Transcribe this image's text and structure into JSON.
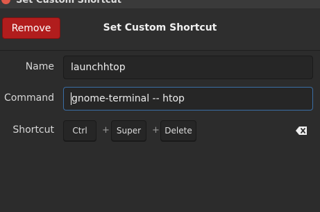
{
  "window": {
    "title": "Set Custom Shortcut"
  },
  "header": {
    "remove_label": "Remove",
    "title": "Set Custom Shortcut"
  },
  "form": {
    "name_label": "Name",
    "name_value": "launchhtop",
    "command_label": "Command",
    "command_value": "gnome-terminal -- htop",
    "shortcut_label": "Shortcut",
    "shortcut_keys": [
      "Ctrl",
      "Super",
      "Delete"
    ],
    "separator": "+"
  },
  "colors": {
    "remove_button": "#b11d1d",
    "focus_border": "#3a6ea5",
    "background": "#2c2c2c"
  },
  "icons": {
    "window_close": "close-icon",
    "clear_shortcut": "backspace-clear-icon"
  }
}
